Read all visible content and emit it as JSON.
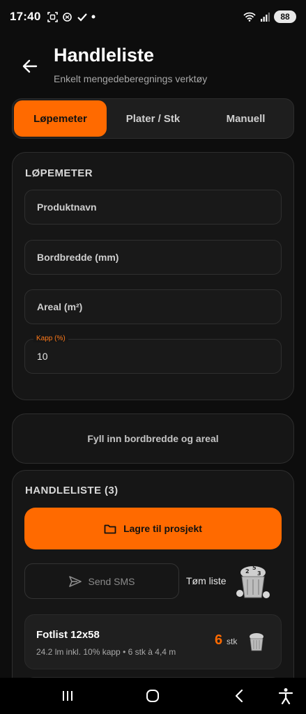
{
  "status": {
    "time": "17:40",
    "battery": "88",
    "icons_left": [
      "screenshot-icon",
      "chatgpt-icon",
      "check-icon",
      "dot-icon"
    ],
    "icons_right": [
      "wifi-icon",
      "signal-icon",
      "battery-icon"
    ]
  },
  "header": {
    "title": "Handleliste",
    "subtitle": "Enkelt mengedeberegnings verktøy"
  },
  "tabs": [
    {
      "label": "Løpemeter",
      "active": true
    },
    {
      "label": "Plater / Stk",
      "active": false
    },
    {
      "label": "Manuell",
      "active": false
    }
  ],
  "lopemeter": {
    "section_title": "LØPEMETER",
    "fields": {
      "product_placeholder": "Produktnavn",
      "width_placeholder": "Bordbredde (mm)",
      "area_placeholder": "Areal (m²)",
      "kapp_label": "Kapp (%)",
      "kapp_value": "10"
    }
  },
  "info": {
    "message": "Fyll inn bordbredde og areal"
  },
  "shopping_list": {
    "title": "HANDLELISTE (3)",
    "save_label": "Lagre til prosjekt",
    "sms_label": "Send SMS",
    "clear_label": "Tøm liste",
    "items": [
      {
        "name": "Fotlist 12x58",
        "desc": "24.2 lm inkl. 10% kapp • 6 stk à 4,4 m",
        "qty": "6",
        "unit": "stk"
      }
    ]
  },
  "colors": {
    "accent": "#ff6a00",
    "background": "#0d0d0d",
    "card": "#161616"
  }
}
